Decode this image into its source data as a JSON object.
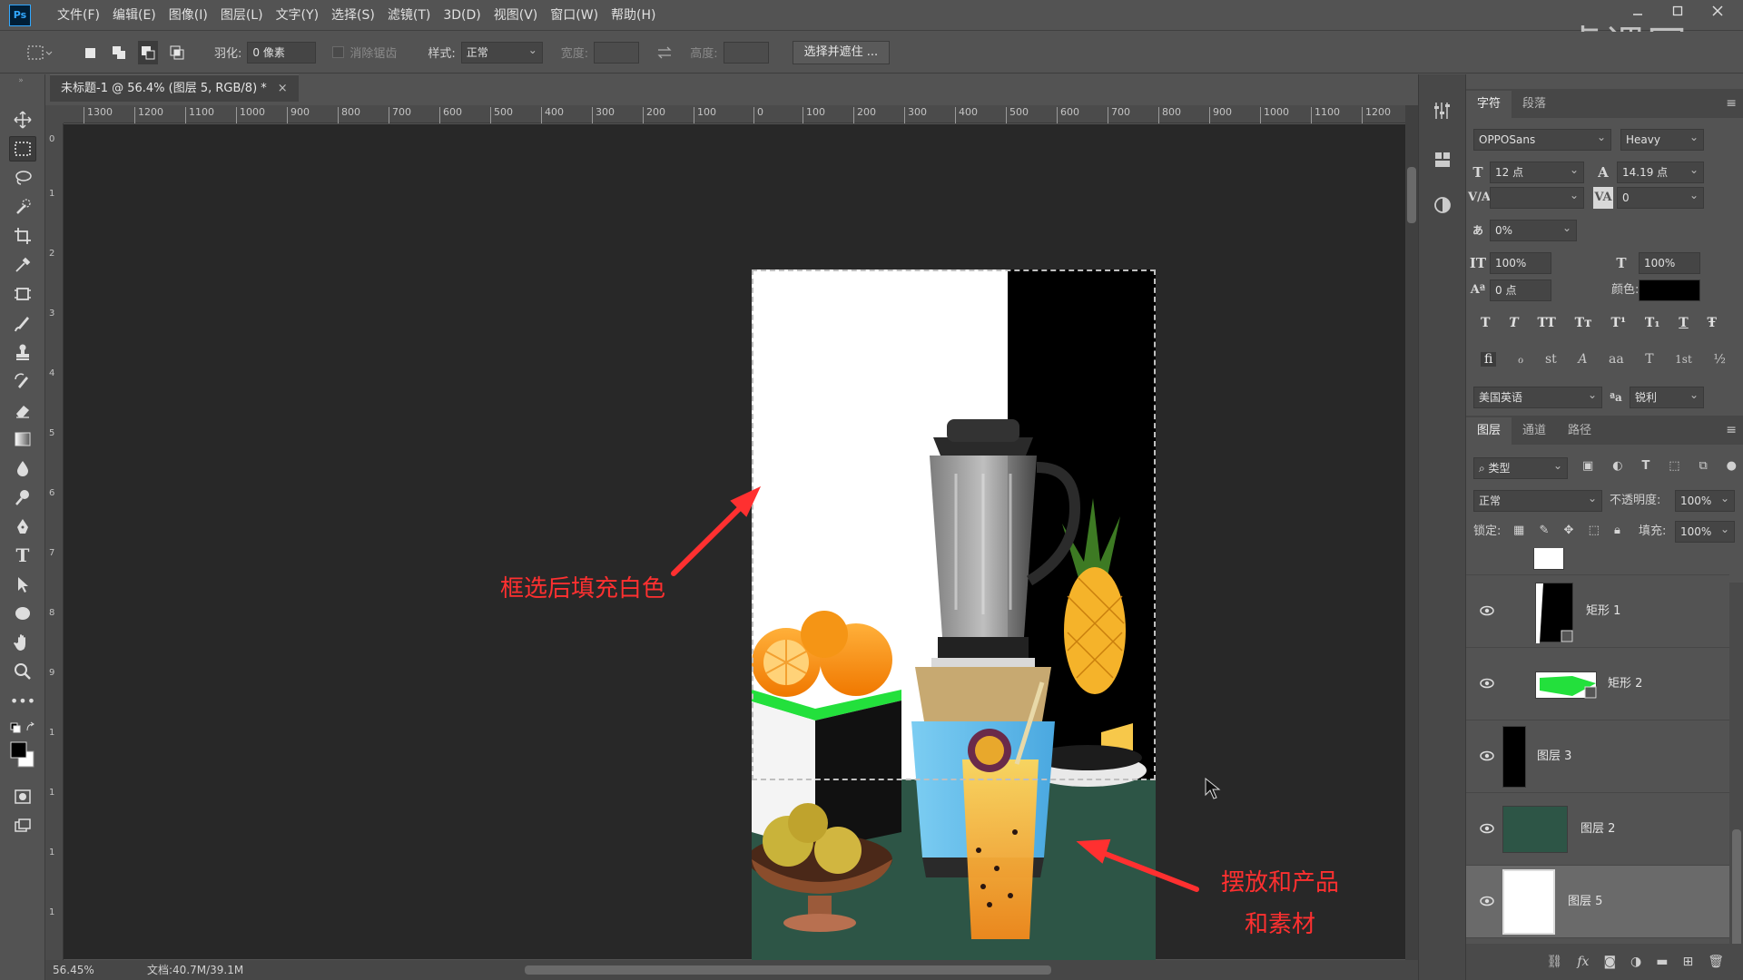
{
  "app": {
    "logo": "Ps"
  },
  "menu": [
    "文件(F)",
    "编辑(E)",
    "图像(I)",
    "图层(L)",
    "文字(Y)",
    "选择(S)",
    "滤镜(T)",
    "3D(D)",
    "视图(V)",
    "窗口(W)",
    "帮助(H)"
  ],
  "watermark": "虎课网",
  "options": {
    "feather_label": "羽化:",
    "feather_value": "0 像素",
    "antialias_label": "消除锯齿",
    "style_label": "样式:",
    "style_value": "正常",
    "width_label": "宽度:",
    "height_label": "高度:",
    "select_mask_button": "选择并遮住 ..."
  },
  "document": {
    "tab_title": "未标题-1 @ 56.4% (图层 5, RGB/8) *",
    "close_glyph": "×",
    "zoom": "56.45%",
    "doc_info": "文档:40.7M/39.1M",
    "ruler_ticks": [
      "1300",
      "1200",
      "1100",
      "1000",
      "900",
      "800",
      "700",
      "600",
      "500",
      "400",
      "300",
      "200",
      "100",
      "0",
      "100",
      "200",
      "300",
      "400",
      "500",
      "600",
      "700",
      "800",
      "900",
      "1000",
      "1100",
      "1200"
    ]
  },
  "annotations": {
    "left": "框选后填充白色",
    "right_line1": "摆放和产品",
    "right_line2": "和素材",
    "color": "#ff3030"
  },
  "character_panel": {
    "tabs": [
      "字符",
      "段落"
    ],
    "font_family": "OPPOSans",
    "font_style": "Heavy",
    "font_size": "12 点",
    "leading": "14.19 点",
    "kerning": "",
    "tracking": "0",
    "tsume": "0%",
    "vertical_scale": "100%",
    "horizontal_scale": "100%",
    "baseline_shift": "0 点",
    "color_label": "颜色:",
    "color_value": "#000000",
    "language": "美国英语",
    "antialias_glyph": "ªa",
    "antialias": "锐利",
    "style_buttons": [
      "T",
      "T",
      "TT",
      "Tт",
      "T¹",
      "T₁",
      "T",
      "Ŧ"
    ],
    "opentype_buttons": [
      "ﬁ",
      "ℴ",
      "st",
      "A",
      "aa",
      "T",
      "1st",
      "½"
    ]
  },
  "layers_panel": {
    "tabs": [
      "图层",
      "通道",
      "路径"
    ],
    "filter_label": "类型",
    "blend_mode": "正常",
    "opacity_label": "不透明度:",
    "opacity_value": "100%",
    "lock_label": "锁定:",
    "fill_label": "填充:",
    "fill_value": "100%",
    "layers": [
      {
        "name": "",
        "partial": true
      },
      {
        "name": "矩形 1"
      },
      {
        "name": "矩形 2"
      },
      {
        "name": "图层 3"
      },
      {
        "name": "图层 2"
      },
      {
        "name": "图层 5",
        "selected": true
      }
    ],
    "footer_icons": [
      "link-icon",
      "fx-icon",
      "mask-icon",
      "adjustment-icon",
      "group-icon",
      "new-layer-icon",
      "trash-icon"
    ],
    "footer_fx": "fx"
  }
}
